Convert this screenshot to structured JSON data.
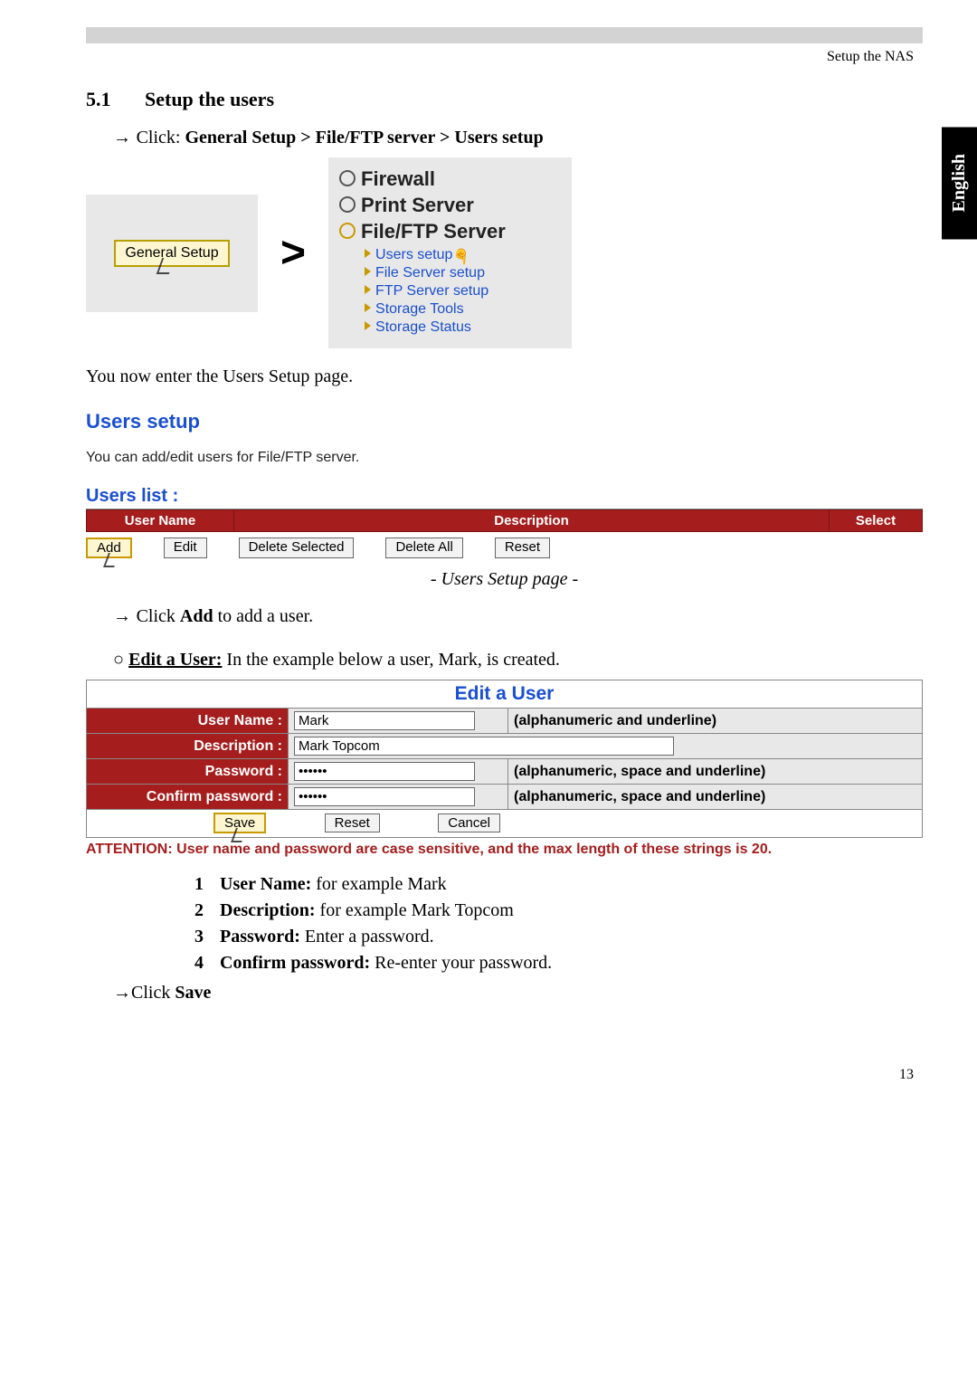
{
  "header": "Setup the NAS",
  "side_tab": "English",
  "section": {
    "num": "5.1",
    "title": "Setup the users"
  },
  "intro_line": {
    "prefix": "Click: ",
    "path": "General Setup > File/FTP server > Users setup"
  },
  "nav": {
    "general_setup": "General Setup",
    "gt": ">",
    "items": [
      "Firewall",
      "Print Server",
      "File/FTP Server"
    ],
    "submenu": [
      "Users setup",
      "File Server setup",
      "FTP Server setup",
      "Storage Tools",
      "Storage Status"
    ]
  },
  "after_nav": "You now enter the Users Setup page.",
  "users_panel": {
    "h1": "Users setup",
    "desc": "You can add/edit users for File/FTP server.",
    "h2": "Users list  :",
    "cols": [
      "User Name",
      "Description",
      "Select"
    ],
    "buttons": [
      "Add",
      "Edit",
      "Delete Selected",
      "Delete All",
      "Reset"
    ]
  },
  "caption": "- Users Setup page -",
  "add_line": {
    "prefix": "Click ",
    "bold": "Add",
    "suffix": " to add a user."
  },
  "edit_line": {
    "title": "Edit a User:",
    "rest": " In the example below a user, Mark, is created."
  },
  "edit_user": {
    "title": "Edit a User",
    "rows": [
      {
        "label": "User Name  :",
        "value": "Mark",
        "hint": "(alphanumeric and underline)"
      },
      {
        "label": "Description  :",
        "value": "Mark Topcom",
        "hint": ""
      },
      {
        "label": "Password  :",
        "value": "••••••",
        "hint": "(alphanumeric, space and underline)"
      },
      {
        "label": "Confirm password  :",
        "value": "••••••",
        "hint": "(alphanumeric, space and underline)"
      }
    ],
    "buttons": [
      "Save",
      "Reset",
      "Cancel"
    ],
    "attention": "ATTENTION: User name and password are case sensitive, and the max length of these strings is 20."
  },
  "field_list": [
    {
      "n": "1",
      "label": "User Name:",
      "text": " for example Mark"
    },
    {
      "n": "2",
      "label": "Description:",
      "text": " for example Mark Topcom"
    },
    {
      "n": "3",
      "label": "Password:",
      "text": " Enter a password."
    },
    {
      "n": "4",
      "label": "Confirm password:",
      "text": " Re-enter your password."
    }
  ],
  "save_line": {
    "prefix": "Click ",
    "bold": "Save"
  },
  "page_number": "13"
}
